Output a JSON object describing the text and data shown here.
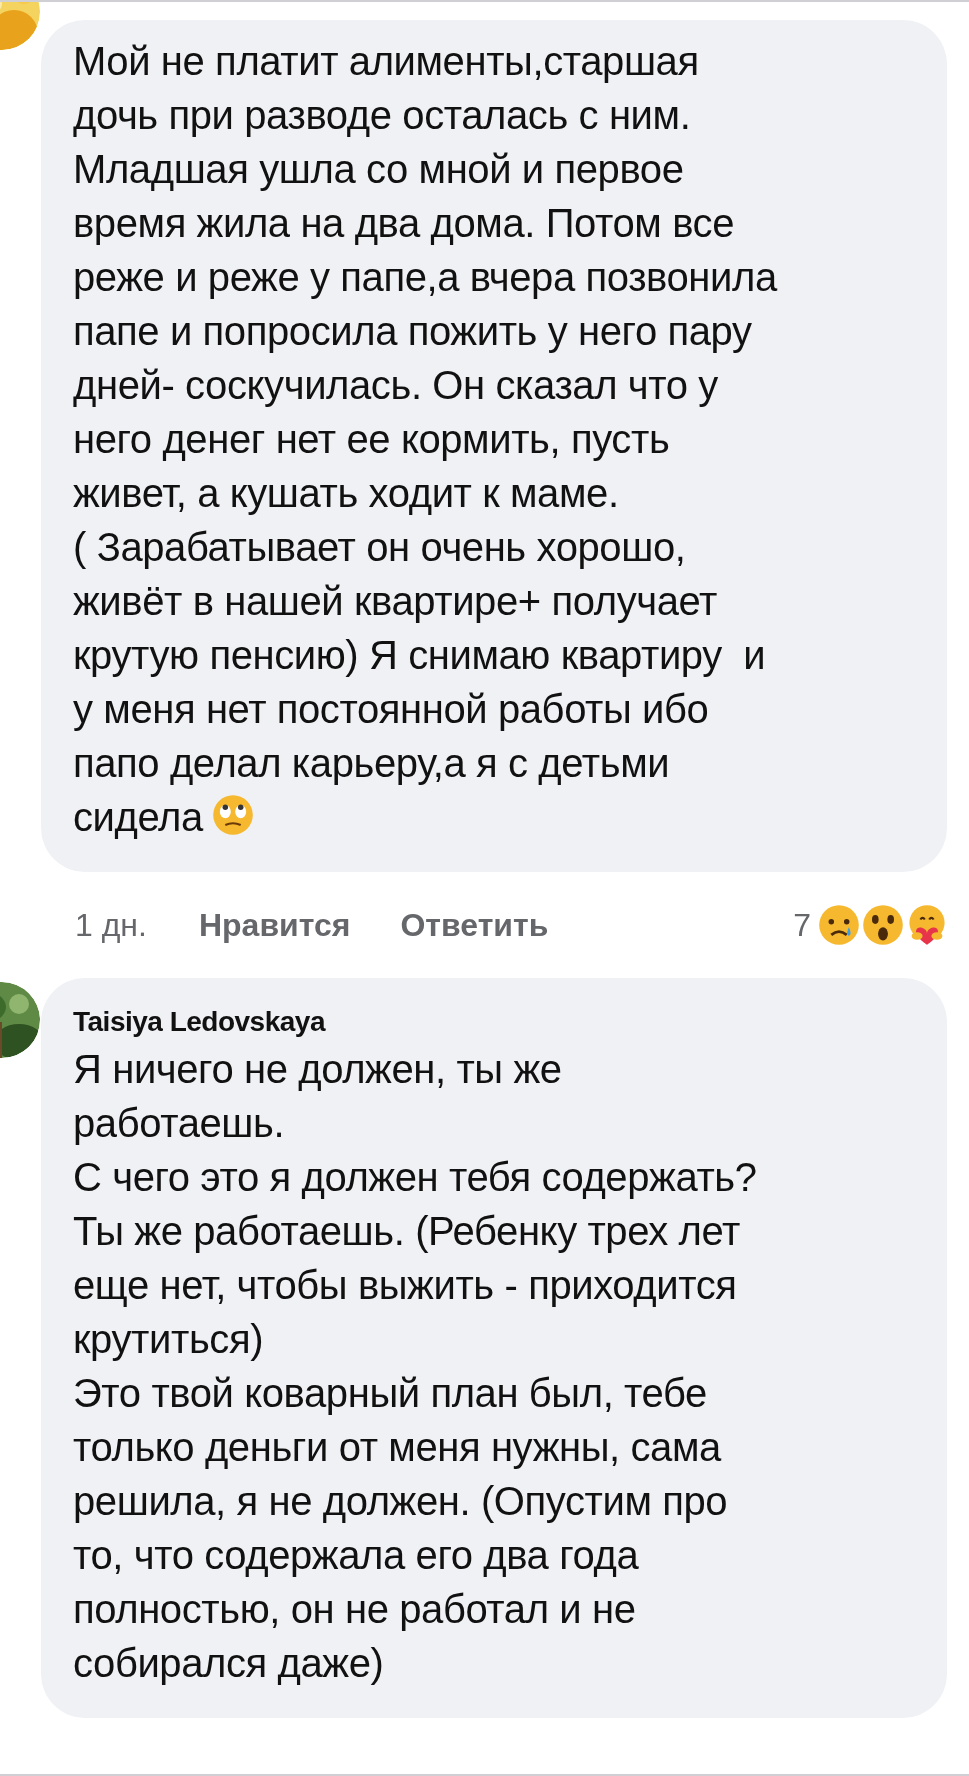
{
  "comments": [
    {
      "text": "Мой не платит алименты,старшая\nдочь при разводе осталась с ним.\nМладшая ушла со мной и первое\nвремя жила на два дома. Потом все\nреже и реже у папе,а вчера позвонила\nпапе и попросила пожить у него пару\nдней- соскучилась. Он сказал что у\nнего денег нет ее кормить, пусть\nживет, а кушать ходит к маме.\n( Зарабатывает он очень хорошо,\nживёт в нашей квартире+ получает\nкрутую пенсию) Я снимаю квартиру  и\nу меня нет постоянной работы ибо\nпапо делал карьеру,а я с детьми\nсидела",
      "trailing_emoji": true,
      "time": "1 дн.",
      "like": "Нравится",
      "reply": "Ответить",
      "reaction_count": "7"
    },
    {
      "author": "Taisiya Ledovskaya",
      "text": "Я ничего не должен, ты же\nработаешь.\nС чего это я должен тебя содержать?\nТы же работаешь. (Ребенку трех лет\nеще нет, чтобы выжить - приходится\nкрутиться)\nЭто твой коварный план был, тебе\nтолько деньги от меня нужны, сама\nрешила, я не должен. (Опустим про\nто, что содержала его два года\nполностью, он не работал и не\nсобирался даже)",
      "trailing_emoji": false
    }
  ]
}
